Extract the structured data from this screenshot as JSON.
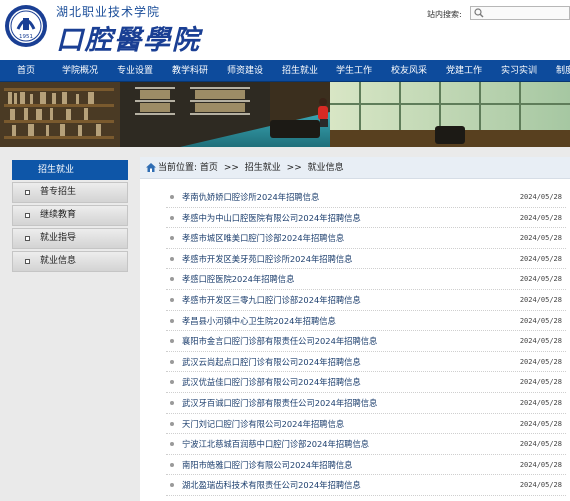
{
  "header": {
    "school_name": "湖北职业技术学院",
    "college_name": "口腔醫學院",
    "logo_year": "1951",
    "search_label": "站内搜索:"
  },
  "nav": {
    "items": [
      "首页",
      "学院概况",
      "专业设置",
      "教学科研",
      "师资建设",
      "招生就业",
      "学生工作",
      "校友风采",
      "党建工作",
      "实习实训",
      "制度"
    ]
  },
  "sidebar": {
    "title": "招生就业",
    "items": [
      "普专招生",
      "继续教育",
      "就业指导",
      "就业信息"
    ]
  },
  "breadcrumb": {
    "prefix": "当前位置:",
    "items": [
      "首页",
      "招生就业",
      "就业信息"
    ],
    "separator": ">>"
  },
  "news": [
    {
      "title": "孝南仇娇娇口腔诊所2024年招聘信息",
      "date": "2024/05/28"
    },
    {
      "title": "孝感中为中山口腔医院有限公司2024年招聘信息",
      "date": "2024/05/28"
    },
    {
      "title": "孝感市城区唯美口腔门诊部2024年招聘信息",
      "date": "2024/05/28"
    },
    {
      "title": "孝感市开发区美牙苑口腔诊所2024年招聘信息",
      "date": "2024/05/28"
    },
    {
      "title": "孝感口腔医院2024年招聘信息",
      "date": "2024/05/28"
    },
    {
      "title": "孝感市开发区三零九口腔门诊部2024年招聘信息",
      "date": "2024/05/28"
    },
    {
      "title": "孝昌县小河镇中心卫生院2024年招聘信息",
      "date": "2024/05/28"
    },
    {
      "title": "襄阳市金言口腔门诊部有限责任公司2024年招聘信息",
      "date": "2024/05/28"
    },
    {
      "title": "武汉云尚起点口腔门诊有限公司2024年招聘信息",
      "date": "2024/05/28"
    },
    {
      "title": "武汉优益佳口腔门诊部有限公司2024年招聘信息",
      "date": "2024/05/28"
    },
    {
      "title": "武汉牙百诚口腔门诊部有限责任公司2024年招聘信息",
      "date": "2024/05/28"
    },
    {
      "title": "天门刘记口腔门诊有限公司2024年招聘信息",
      "date": "2024/05/28"
    },
    {
      "title": "宁波江北慈城百润慈中口腔门诊部2024年招聘信息",
      "date": "2024/05/28"
    },
    {
      "title": "南阳市皓雅口腔门诊有限公司2024年招聘信息",
      "date": "2024/05/28"
    },
    {
      "title": "湖北盈瑞齿科技术有限责任公司2024年招聘信息",
      "date": "2024/05/28"
    }
  ],
  "colors": {
    "nav_bg": "#0d4b9c",
    "sidebar_title_bg": "#0e56a8",
    "content_bg": "#eaeaea",
    "link_text": "#1d3f6e"
  }
}
